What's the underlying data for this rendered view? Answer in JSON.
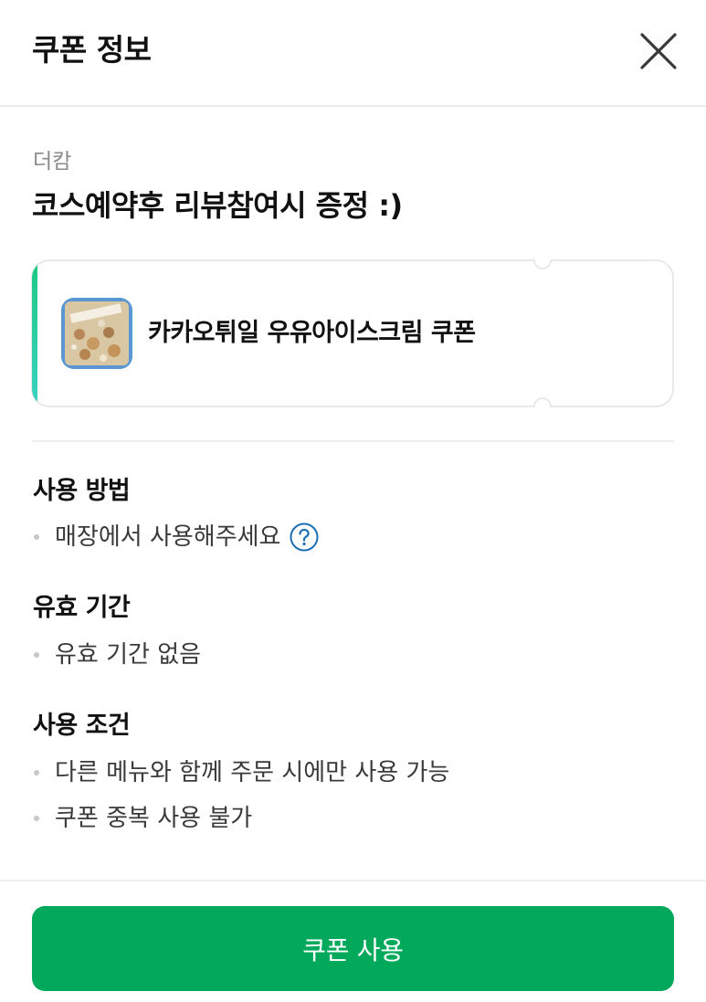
{
  "header": {
    "title": "쿠폰 정보"
  },
  "coupon": {
    "store_name": "더캄",
    "title": "코스예약후 리뷰참여시 증정 :)",
    "ticket_label": "카카오튀일 우유아이스크림 쿠폰"
  },
  "sections": [
    {
      "title": "사용 방법",
      "items": [
        "매장에서 사용해주세요"
      ]
    },
    {
      "title": "유효 기간",
      "items": [
        "유효 기간 없음"
      ]
    },
    {
      "title": "사용 조건",
      "items": [
        "다른 메뉴와 함께 주문 시에만 사용 가능",
        "쿠폰 중복 사용 불가"
      ]
    }
  ],
  "footer": {
    "use_button_label": "쿠폰 사용"
  },
  "icons": {
    "close": "close-icon",
    "help": "question-circle-icon"
  },
  "colors": {
    "primary_green": "#03a95a",
    "ticket_accent_top": "#1cc982",
    "ticket_accent_bottom": "#3bd2c3",
    "help_blue": "#1c6fb5"
  }
}
